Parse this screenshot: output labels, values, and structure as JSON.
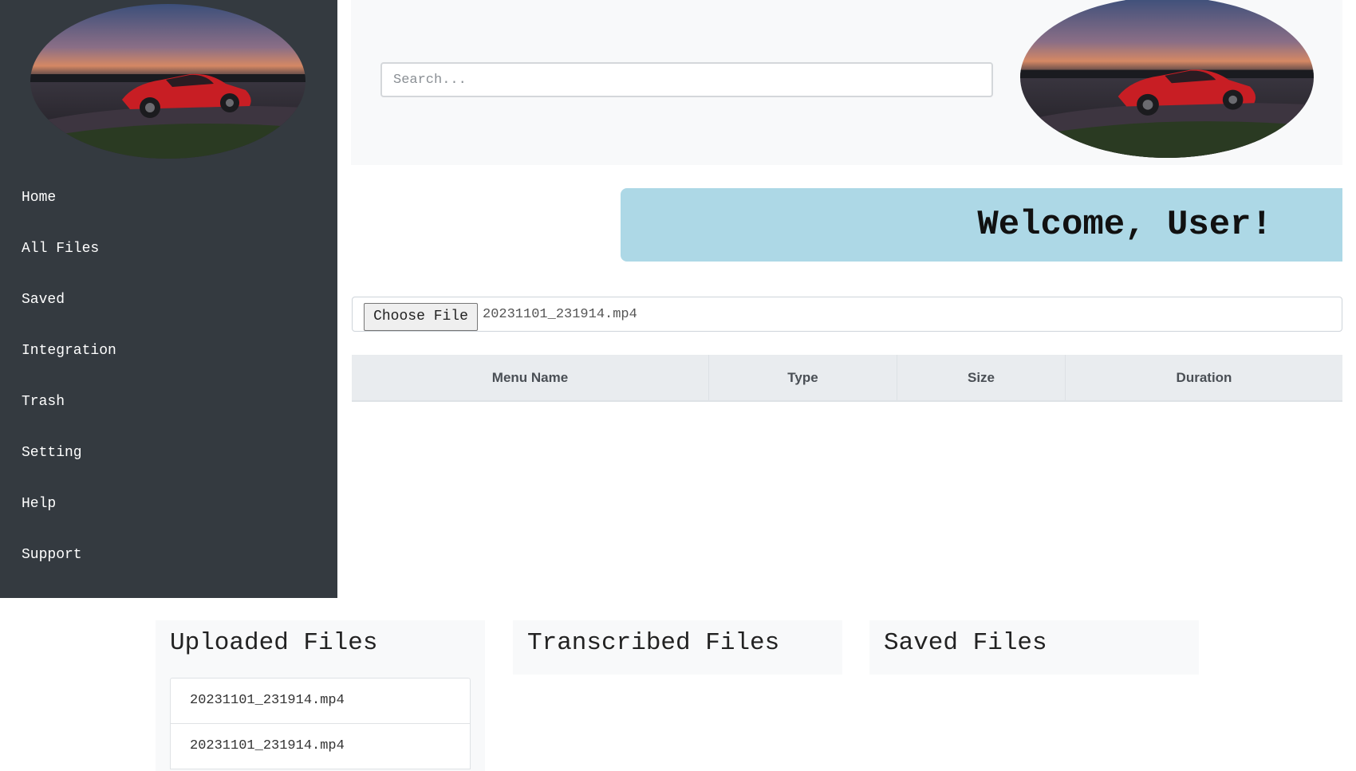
{
  "sidebar": {
    "logo_alt": "car-logo",
    "items": [
      {
        "label": "Home"
      },
      {
        "label": "All Files"
      },
      {
        "label": "Saved"
      },
      {
        "label": "Integration"
      },
      {
        "label": "Trash"
      },
      {
        "label": "Setting"
      },
      {
        "label": "Help"
      },
      {
        "label": "Support"
      }
    ]
  },
  "header": {
    "search_placeholder": "Search...",
    "search_value": ""
  },
  "welcome": {
    "text": "Welcome, User!"
  },
  "upload": {
    "button_label": "Choose File",
    "selected_file": "20231101_231914.mp4"
  },
  "table": {
    "columns": [
      "Menu Name",
      "Type",
      "Size",
      "Duration"
    ],
    "rows": []
  },
  "panels": {
    "uploaded": {
      "title": "Uploaded Files",
      "files": [
        "20231101_231914.mp4",
        "20231101_231914.mp4"
      ]
    },
    "transcribed": {
      "title": "Transcribed Files",
      "files": []
    },
    "saved": {
      "title": "Saved Files",
      "files": []
    }
  },
  "colors": {
    "sidebar_bg": "#343a40",
    "header_bg": "#f8f9fa",
    "welcome_bg": "#add8e6",
    "table_header_bg": "#e9ecef"
  }
}
